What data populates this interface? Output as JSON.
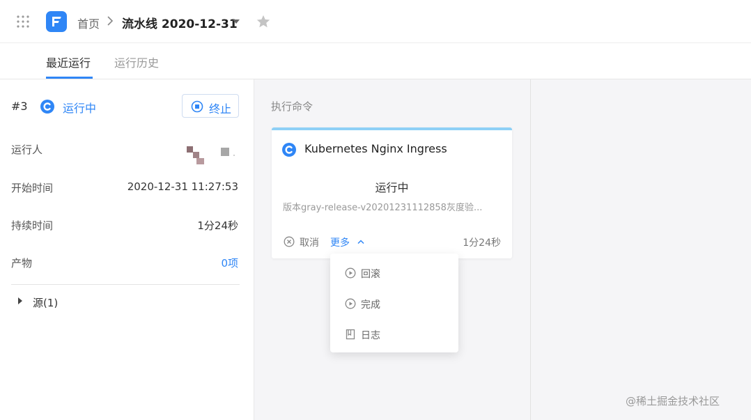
{
  "header": {
    "breadcrumb_home": "首页",
    "breadcrumb_current": "流水线 2020-12-31"
  },
  "tabs": [
    {
      "label": "最近运行",
      "active": true
    },
    {
      "label": "运行历史",
      "active": false
    }
  ],
  "run": {
    "number": "#3",
    "status": "运行中",
    "stop_label": "终止",
    "fields": [
      {
        "label": "运行人",
        "value": ""
      },
      {
        "label": "开始时间",
        "value": "2020-12-31 11:27:53"
      },
      {
        "label": "持续时间",
        "value": "1分24秒"
      },
      {
        "label": "产物",
        "value": "0项"
      }
    ],
    "source_label": "源(1)"
  },
  "stage": {
    "title": "执行命令",
    "card": {
      "title": "Kubernetes Nginx Ingress",
      "status": "运行中",
      "version": "版本gray-release-v20201231112858灰度验...",
      "cancel_label": "取消",
      "more_label": "更多",
      "duration": "1分24秒"
    },
    "menu": [
      {
        "label": "回滚",
        "icon": "play-circle-icon"
      },
      {
        "label": "完成",
        "icon": "play-circle-icon"
      },
      {
        "label": "日志",
        "icon": "document-icon"
      }
    ]
  },
  "watermark": "@稀土掘金技术社区",
  "colors": {
    "accent": "#2f86f6",
    "card_top_bar": "#8ed0f6"
  }
}
